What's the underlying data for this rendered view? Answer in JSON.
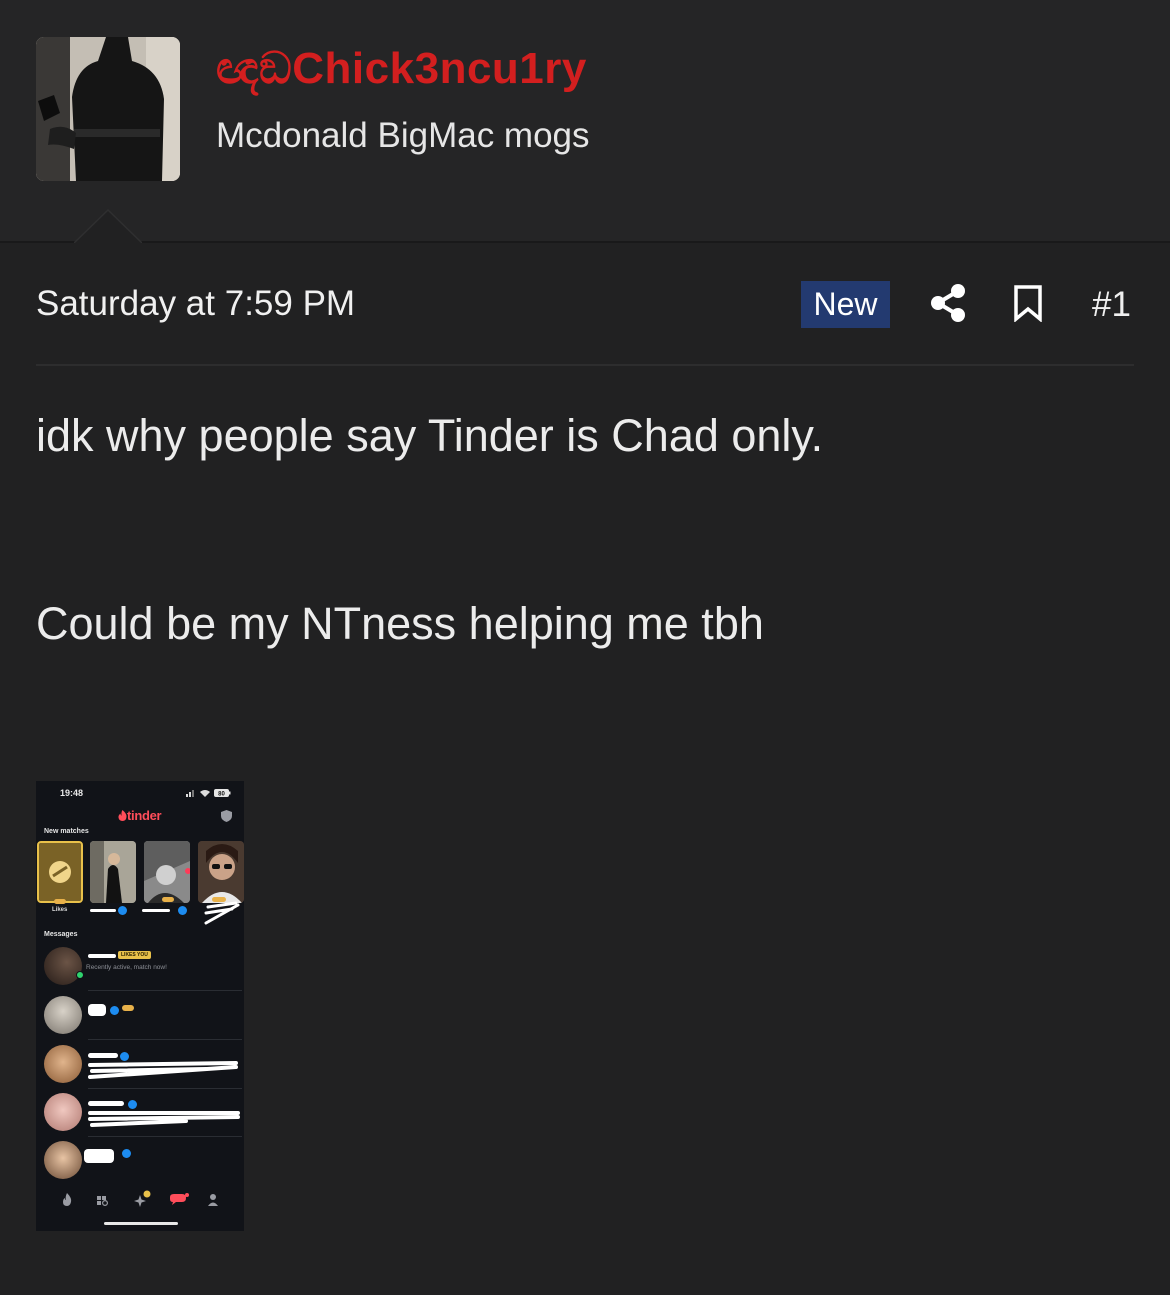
{
  "user": {
    "name": "ඥඞChick3ncu1ry",
    "title": "Mcdonald BigMac mogs",
    "name_color": "#d31f1f"
  },
  "post": {
    "date": "Saturday at 7:59 PM",
    "badge": "New",
    "number": "#1",
    "lines": [
      "idk why people say Tinder is Chad only.",
      "Could be my NTness helping me tbh"
    ],
    "icons": [
      "share-icon",
      "bookmark-icon"
    ]
  },
  "attachment": {
    "time": "19:48",
    "battery": "80",
    "app_logo": "tinder",
    "new_matches_label": "New matches",
    "likes_label": "Likes",
    "messages_label": "Messages",
    "likes_you_badge": "LIKES YOU",
    "recent_text": "Recently active, match now!",
    "tab_icons": [
      "flame-icon",
      "explore-icon",
      "spark-icon",
      "chat-icon",
      "profile-icon"
    ]
  },
  "colors": {
    "background": "#212122",
    "header": "#252526",
    "badge": "#233a70",
    "tinder": "#ff4d5a"
  }
}
